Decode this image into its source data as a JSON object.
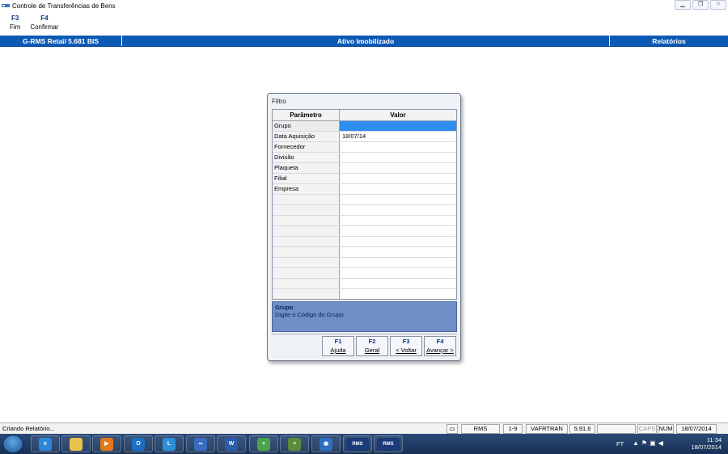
{
  "window": {
    "title": "Controle de Transferências de Bens",
    "min_icon": "minimize-icon",
    "max_icon": "maximize-icon",
    "close_icon": "close-icon"
  },
  "toolbar": {
    "keys": [
      {
        "key": "F3",
        "label": "Fim"
      },
      {
        "key": "F4",
        "label": "Confirmar"
      }
    ]
  },
  "header": {
    "left": "G-RMS Retail 5.681 BIS",
    "center": "Ativo Imobilizado",
    "right": "Relatórios"
  },
  "dialog": {
    "title": "Filtro",
    "columns": {
      "param": "Parâmetro",
      "value": "Valor"
    },
    "rows": [
      {
        "param": "Grupo",
        "value": ""
      },
      {
        "param": "Data Aquisição",
        "value": "18/07/14"
      },
      {
        "param": "Fornecedor",
        "value": ""
      },
      {
        "param": "Divisão",
        "value": ""
      },
      {
        "param": "Plaqueta",
        "value": ""
      },
      {
        "param": "Filial",
        "value": ""
      },
      {
        "param": "Empresa",
        "value": ""
      },
      {
        "param": "",
        "value": ""
      },
      {
        "param": "",
        "value": ""
      },
      {
        "param": "",
        "value": ""
      },
      {
        "param": "",
        "value": ""
      },
      {
        "param": "",
        "value": ""
      },
      {
        "param": "",
        "value": ""
      },
      {
        "param": "",
        "value": ""
      },
      {
        "param": "",
        "value": ""
      },
      {
        "param": "",
        "value": ""
      },
      {
        "param": "",
        "value": ""
      }
    ],
    "selected_row": 0,
    "help": {
      "title": "Grupo",
      "text": "Digite o Código do Grupo"
    },
    "buttons": [
      {
        "key": "F1",
        "label": "Ajuda"
      },
      {
        "key": "F2",
        "label": "Geral"
      },
      {
        "key": "F3",
        "label": "< Voltar"
      },
      {
        "key": "F4",
        "label": "Avançar >"
      }
    ]
  },
  "statusbar": {
    "message": "Criando Relatório...",
    "cells": [
      "RMS",
      "1-9",
      "VAFRTRAN",
      "5.91.6",
      "",
      "CAPS",
      "NUM",
      "18/07/2014"
    ],
    "dim_cells": [
      "CAPS"
    ]
  },
  "taskbar": {
    "lang": "FT",
    "time": "11:34",
    "date": "18/07/2014",
    "apps": [
      {
        "name": "internet-explorer",
        "text": "e",
        "color": "#2d86d8"
      },
      {
        "name": "file-explorer",
        "text": "",
        "color": "#e8c24a"
      },
      {
        "name": "media-player",
        "text": "▶",
        "color": "#e07a1c"
      },
      {
        "name": "outlook",
        "text": "O",
        "color": "#1d6fc4"
      },
      {
        "name": "lync",
        "text": "L",
        "color": "#2f8fd6"
      },
      {
        "name": "connect",
        "text": "∞",
        "color": "#3a6cc0"
      },
      {
        "name": "word",
        "text": "W",
        "color": "#2b5cab"
      },
      {
        "name": "app-green",
        "text": "+",
        "color": "#4aa34a"
      },
      {
        "name": "app-stack",
        "text": "≡",
        "color": "#5a8a3a"
      },
      {
        "name": "app-globe",
        "text": "◉",
        "color": "#2d6fc0"
      },
      {
        "name": "rms-1",
        "text": "RMS",
        "color": "#1a3a78"
      },
      {
        "name": "rms-2",
        "text": "RMS",
        "color": "#1a3a78"
      }
    ]
  }
}
